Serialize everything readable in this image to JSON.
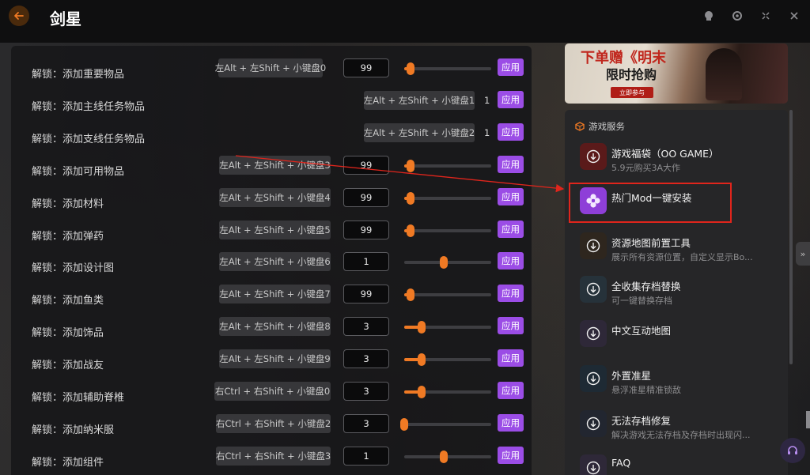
{
  "window": {
    "title": "剑星",
    "controls": [
      "window-status-icon",
      "settings-icon",
      "minimize-icon",
      "close-icon"
    ]
  },
  "options": [
    {
      "label": "解锁：添加重要物品",
      "hotkey": "左Alt + 左Shift + 小键盘0",
      "control": "slider",
      "value": "99",
      "level": 0.07,
      "apply": "应用"
    },
    {
      "label": "解锁：添加主线任务物品",
      "hotkey": "左Alt + 左Shift + 小键盘1",
      "control": "text",
      "value": "1",
      "apply": "应用"
    },
    {
      "label": "解锁：添加支线任务物品",
      "hotkey": "左Alt + 左Shift + 小键盘2",
      "control": "text",
      "value": "1",
      "apply": "应用"
    },
    {
      "label": "解锁：添加可用物品",
      "hotkey": "左Alt + 左Shift + 小键盘3",
      "control": "slider",
      "value": "99",
      "level": 0.07,
      "apply": "应用"
    },
    {
      "label": "解锁：添加材料",
      "hotkey": "左Alt + 左Shift + 小键盘4",
      "control": "slider",
      "value": "99",
      "level": 0.07,
      "apply": "应用"
    },
    {
      "label": "解锁：添加弹药",
      "hotkey": "左Alt + 左Shift + 小键盘5",
      "control": "slider",
      "value": "99",
      "level": 0.07,
      "apply": "应用"
    },
    {
      "label": "解锁：添加设计图",
      "hotkey": "左Alt + 左Shift + 小键盘6",
      "control": "slider",
      "value": "1",
      "level": 0.45,
      "fill": false,
      "apply": "应用"
    },
    {
      "label": "解锁：添加鱼类",
      "hotkey": "左Alt + 左Shift + 小键盘7",
      "control": "slider",
      "value": "99",
      "level": 0.07,
      "apply": "应用"
    },
    {
      "label": "解锁：添加饰品",
      "hotkey": "左Alt + 左Shift + 小键盘8",
      "control": "slider",
      "value": "3",
      "level": 0.2,
      "apply": "应用"
    },
    {
      "label": "解锁：添加战友",
      "hotkey": "左Alt + 左Shift + 小键盘9",
      "control": "slider",
      "value": "3",
      "level": 0.2,
      "apply": "应用"
    },
    {
      "label": "解锁：添加辅助脊椎",
      "hotkey": "右Ctrl + 右Shift + 小键盘0",
      "control": "slider",
      "value": "3",
      "level": 0.2,
      "apply": "应用"
    },
    {
      "label": "解锁：添加纳米服",
      "hotkey": "右Ctrl + 右Shift + 小键盘2",
      "control": "slider",
      "value": "3",
      "level": 0.0,
      "apply": "应用"
    },
    {
      "label": "解锁：添加组件",
      "hotkey": "右Ctrl + 右Shift + 小键盘3",
      "control": "slider",
      "value": "1",
      "level": 0.45,
      "fill": false,
      "apply": "应用"
    }
  ],
  "banner": {
    "title": "下单赠《明末",
    "subtitle": "限时抢购",
    "button": "立即参与"
  },
  "services": {
    "header": "游戏服务",
    "items": [
      {
        "title": "游戏福袋（OO GAME）",
        "desc": "5.9元购买3A大作",
        "icon_color": "#5a1a1a",
        "icon": "download-circle-icon"
      },
      {
        "title": "热门Mod一键安装",
        "desc": "",
        "icon_color": "#8e3fd8",
        "icon": "mod-flower-icon"
      },
      {
        "title": "资源地图前置工具",
        "desc": "展示所有资源位置，自定义显示Bo...",
        "icon_color": "#2e261e",
        "icon": "download-circle-icon"
      },
      {
        "title": "全收集存档替换",
        "desc": "可一键替换存档",
        "icon_color": "#26323a",
        "icon": "download-circle-icon"
      },
      {
        "title": "中文互动地图",
        "desc": "",
        "icon_color": "#2e2838",
        "icon": "download-circle-icon"
      },
      {
        "title": "外置准星",
        "desc": "悬浮准星精准锁敌",
        "icon_color": "#1e2a34",
        "icon": "download-circle-icon"
      },
      {
        "title": "无法存档修复",
        "desc": "解决游戏无法存档及存档时出现闪...",
        "icon_color": "#222630",
        "icon": "download-circle-icon"
      },
      {
        "title": "FAQ",
        "desc": "",
        "icon_color": "#2e2838",
        "icon": "download-circle-icon"
      }
    ]
  },
  "expand_handle": "»",
  "colors": {
    "accent_orange": "#f07a24",
    "apply_purple": "#9b4de6",
    "highlight_red": "#e0251c"
  }
}
